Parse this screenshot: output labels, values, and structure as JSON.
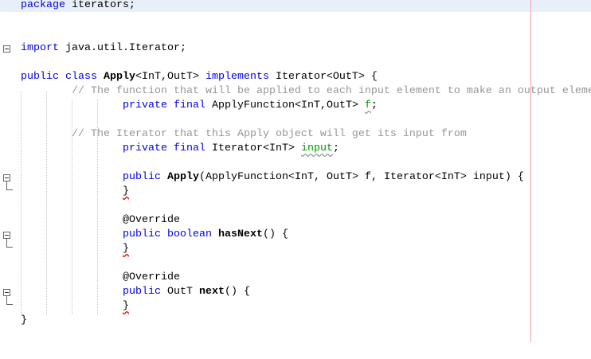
{
  "editor": {
    "colors": {
      "keyword": "#0000e6",
      "comment": "#969696",
      "field": "#009900",
      "margin": "#f4a0a0",
      "current_line": "#e9eff8"
    },
    "lines": [
      {
        "n": 0,
        "indent": 0,
        "tokens": [
          [
            "package",
            "kw"
          ],
          [
            " iterators;",
            ""
          ]
        ]
      },
      {
        "n": 3,
        "indent": 0,
        "tokens": [
          [
            "import",
            "kw"
          ],
          [
            " java.util.Iterator;",
            ""
          ]
        ]
      },
      {
        "n": 5,
        "indent": 0,
        "tokens": [
          [
            "public class",
            "kw"
          ],
          [
            " ",
            ""
          ],
          [
            "Apply",
            "bold"
          ],
          [
            "<InT,OutT> ",
            ""
          ],
          [
            "implements",
            "kw"
          ],
          [
            " Iterator<OutT> {",
            ""
          ]
        ]
      },
      {
        "n": 6,
        "indent": 8,
        "tokens": [
          [
            "// The function that will be applied to each input element to make an output element",
            "cm"
          ]
        ]
      },
      {
        "n": 7,
        "indent": 16,
        "tokens": [
          [
            "private final",
            "kw"
          ],
          [
            " ApplyFunction<InT,OutT> ",
            ""
          ],
          [
            "f",
            "fld"
          ],
          [
            ";",
            ""
          ]
        ]
      },
      {
        "n": 9,
        "indent": 8,
        "tokens": [
          [
            "// The Iterator that this Apply object will get its input from",
            "cm"
          ]
        ]
      },
      {
        "n": 10,
        "indent": 16,
        "tokens": [
          [
            "private final",
            "kw"
          ],
          [
            " Iterator<InT> ",
            ""
          ],
          [
            "input",
            "fld"
          ],
          [
            ";",
            ""
          ]
        ]
      },
      {
        "n": 12,
        "indent": 16,
        "tokens": [
          [
            "public",
            "kw"
          ],
          [
            " ",
            ""
          ],
          [
            "Apply",
            "bold"
          ],
          [
            "(ApplyFunction<InT, OutT> f, Iterator<InT> input) {",
            ""
          ]
        ]
      },
      {
        "n": 13,
        "indent": 16,
        "tokens": [
          [
            "}",
            "err"
          ]
        ]
      },
      {
        "n": 15,
        "indent": 16,
        "tokens": [
          [
            "@Override",
            ""
          ]
        ]
      },
      {
        "n": 16,
        "indent": 16,
        "tokens": [
          [
            "public boolean",
            "kw"
          ],
          [
            " ",
            ""
          ],
          [
            "hasNext",
            "bold"
          ],
          [
            "() {",
            ""
          ]
        ]
      },
      {
        "n": 17,
        "indent": 16,
        "tokens": [
          [
            "}",
            "err"
          ]
        ]
      },
      {
        "n": 19,
        "indent": 16,
        "tokens": [
          [
            "@Override",
            ""
          ]
        ]
      },
      {
        "n": 20,
        "indent": 16,
        "tokens": [
          [
            "public",
            "kw"
          ],
          [
            " OutT ",
            ""
          ],
          [
            "next",
            "bold"
          ],
          [
            "() {",
            ""
          ]
        ]
      },
      {
        "n": 21,
        "indent": 16,
        "tokens": [
          [
            "}",
            "err"
          ]
        ]
      },
      {
        "n": 22,
        "indent": 0,
        "tokens": [
          [
            "}",
            ""
          ]
        ]
      }
    ],
    "folds": [
      3,
      12,
      16,
      20
    ]
  }
}
